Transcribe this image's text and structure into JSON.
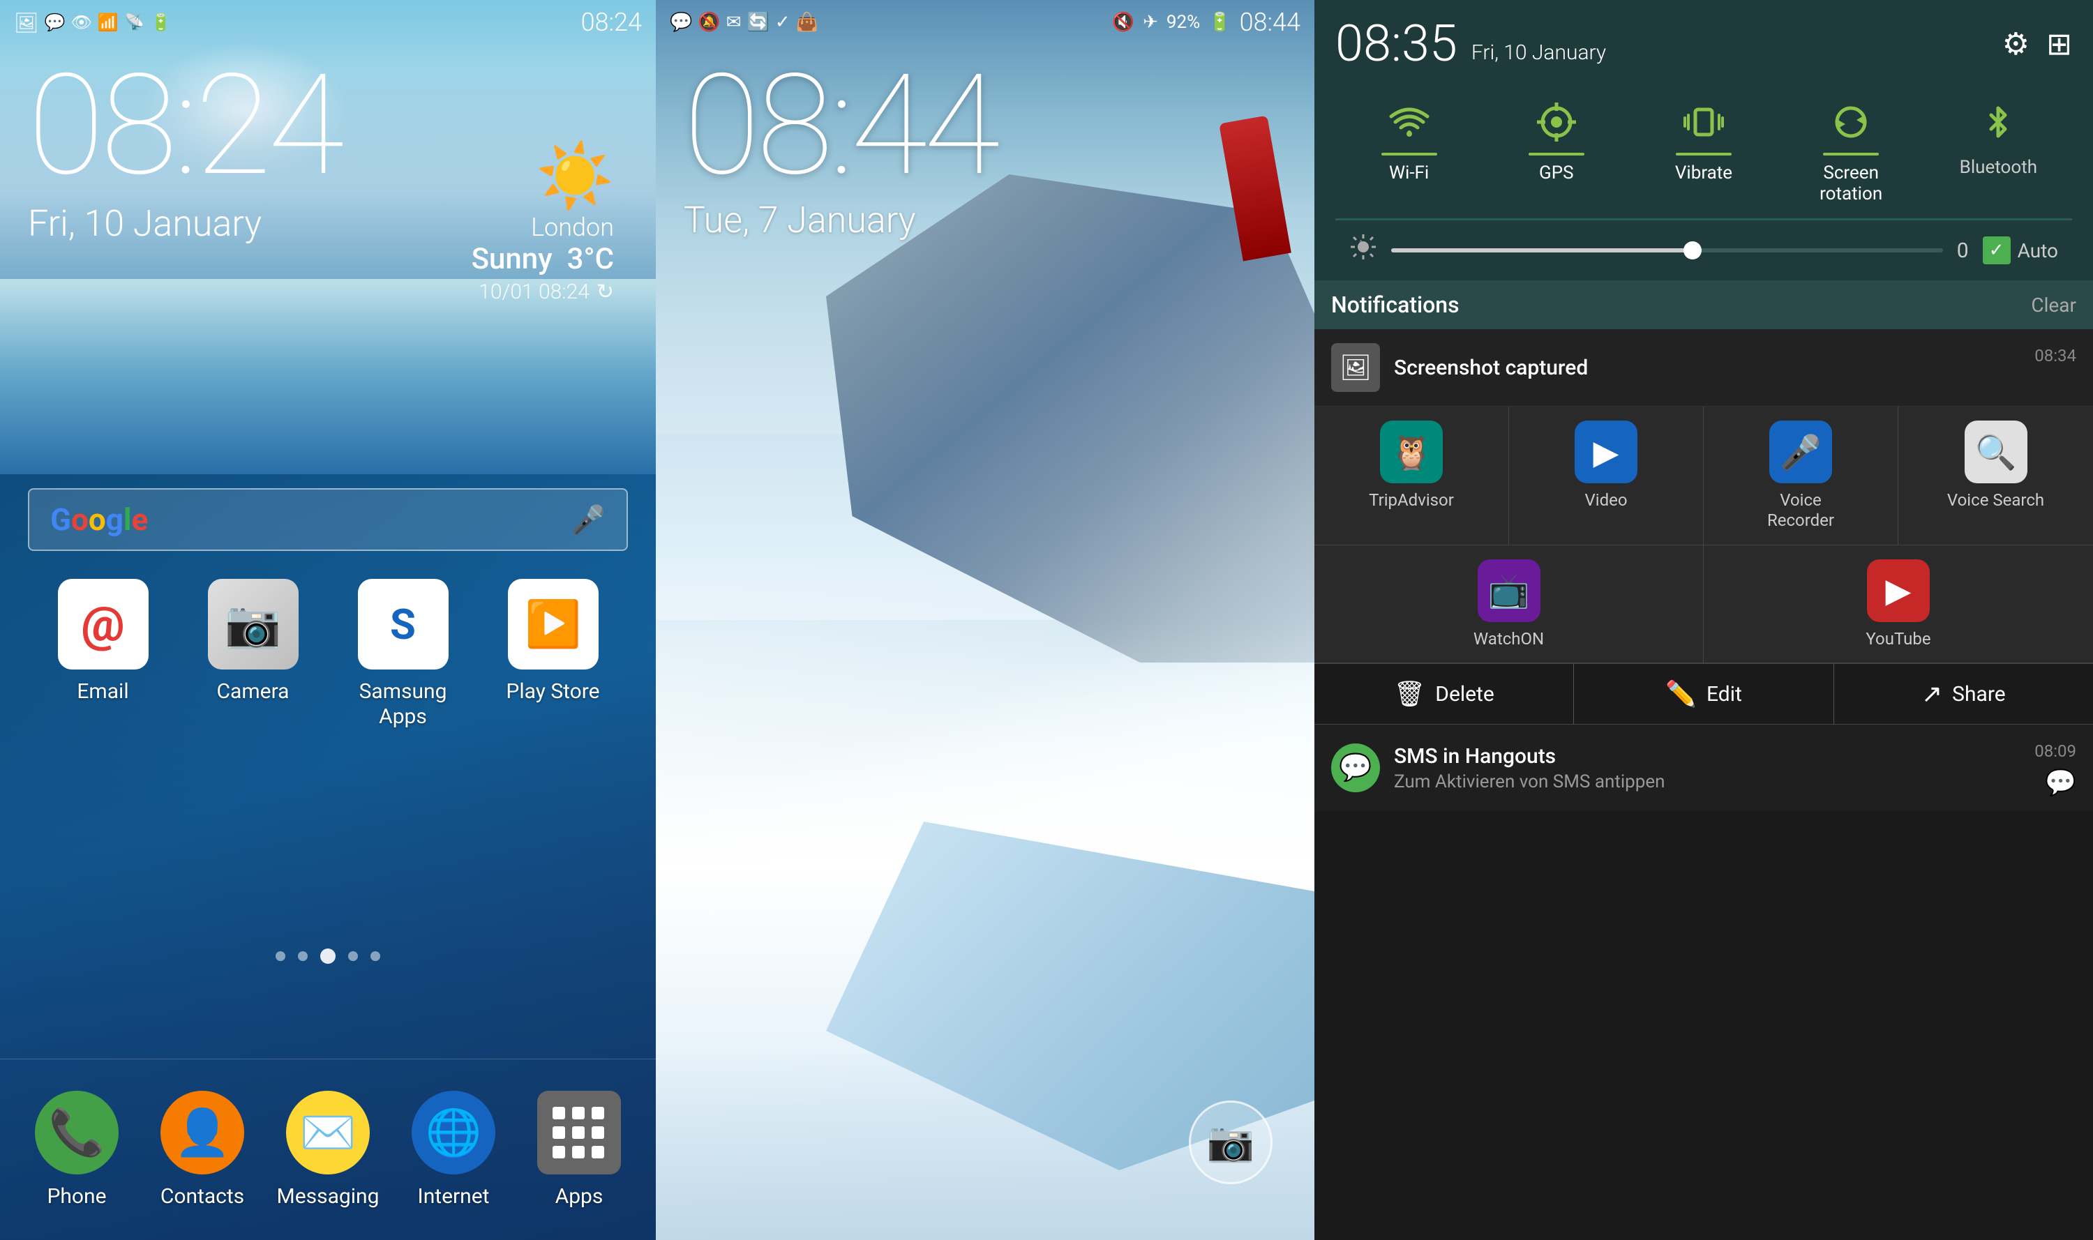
{
  "panel1": {
    "status_bar": {
      "time": "08:24",
      "left_icons": [
        "gallery-icon",
        "hangouts-icon",
        "eye-icon",
        "wifi-icon",
        "signal-icon",
        "battery-icon"
      ]
    },
    "time_display": "08:24",
    "date_display": "Fri, 10 January",
    "weather": {
      "city": "London",
      "condition": "Sunny",
      "temperature": "3°C",
      "datetime": "10/01  08:24"
    },
    "search_bar": {
      "brand": "Google",
      "placeholder": "Google"
    },
    "apps": [
      {
        "label": "Email",
        "icon": "email"
      },
      {
        "label": "Camera",
        "icon": "camera"
      },
      {
        "label": "Samsung\nApps",
        "icon": "samsung"
      },
      {
        "label": "Play Store",
        "icon": "playstore"
      }
    ],
    "dock": [
      {
        "label": "Phone",
        "icon": "phone"
      },
      {
        "label": "Contacts",
        "icon": "contacts"
      },
      {
        "label": "Messaging",
        "icon": "messaging"
      },
      {
        "label": "Internet",
        "icon": "internet"
      },
      {
        "label": "Apps",
        "icon": "apps"
      }
    ]
  },
  "panel2": {
    "status_bar": {
      "left_icons": [
        "hangouts-icon",
        "mute-icon",
        "email-icon",
        "sync-icon",
        "checkbox-icon",
        "bag-icon"
      ],
      "right_section": {
        "mute": "mute-icon",
        "airplane": "airplane-icon",
        "battery": "92%",
        "time": "08:44"
      }
    },
    "time_display": "08:44",
    "date_display": "Tue, 7 January"
  },
  "panel3": {
    "header": {
      "time": "08:35",
      "date": "Fri, 10 January",
      "icons": [
        "settings-icon",
        "grid-icon"
      ]
    },
    "toggles": [
      {
        "label": "Wi-Fi",
        "icon": "📶",
        "active": true
      },
      {
        "label": "GPS",
        "icon": "🎯",
        "active": true
      },
      {
        "label": "Vibrate",
        "icon": "📳",
        "active": true
      },
      {
        "label": "Screen\nrotation",
        "icon": "🔄",
        "active": true
      },
      {
        "label": "Bluetooth",
        "icon": "₿",
        "active": false
      }
    ],
    "brightness": {
      "value": "0",
      "auto_label": "Auto"
    },
    "notifications_label": "Notifications",
    "clear_label": "Clear",
    "screenshot_notif": {
      "title": "Screenshot captured",
      "time": "08:34"
    },
    "apps_row": [
      {
        "label": "TripAdvisor",
        "color": "#00897b"
      },
      {
        "label": "Video",
        "color": "#1565c0"
      },
      {
        "label": "Voice\nRecorder",
        "color": "#1565c0"
      },
      {
        "label": "Voice Search",
        "color": "#e0e0e0"
      }
    ],
    "apps_row2": [
      {
        "label": "WatchON",
        "color": "#6a1b9a"
      },
      {
        "label": "YouTube",
        "color": "#c62828"
      }
    ],
    "actions": [
      {
        "label": "Delete",
        "icon": "🗑"
      },
      {
        "label": "Edit",
        "icon": "✏️"
      },
      {
        "label": "Share",
        "icon": "↗"
      }
    ],
    "sms_notif": {
      "title": "SMS in Hangouts",
      "subtitle": "Zum Aktivieren von SMS antippen",
      "time": "08:09"
    }
  }
}
